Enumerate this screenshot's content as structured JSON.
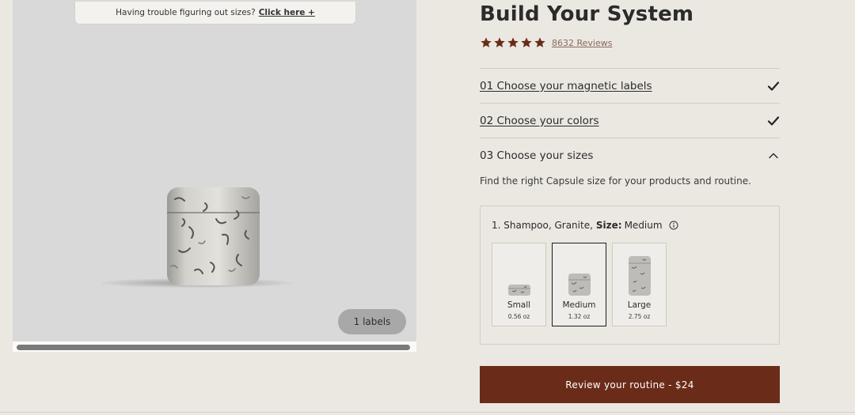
{
  "banner": {
    "text": "Having trouble figuring out sizes?",
    "link": "Click here +"
  },
  "gallery": {
    "labels_badge": "1 labels"
  },
  "product": {
    "title": "Build Your System",
    "rating_stars": 5,
    "reviews_label": "8632 Reviews"
  },
  "steps": [
    {
      "label": "01 Choose your magnetic labels",
      "state": "complete",
      "icon": "check-icon"
    },
    {
      "label": "02 Choose your colors",
      "state": "complete",
      "icon": "check-icon"
    },
    {
      "label": "03 Choose your sizes",
      "state": "expanded",
      "icon": "chevron-up-icon"
    }
  ],
  "sizes": {
    "description": "Find the right Capsule size for your products and routine.",
    "item_prefix": "1. Shampoo, Granite,",
    "size_key": "Size:",
    "selected_value": "Medium",
    "options": [
      {
        "name": "Small",
        "oz": "0.56 oz"
      },
      {
        "name": "Medium",
        "oz": "1.32 oz"
      },
      {
        "name": "Large",
        "oz": "2.75 oz"
      }
    ]
  },
  "cta": {
    "label": "Review your routine - $24"
  },
  "colors": {
    "accent": "#6a2c18",
    "star": "#6a2c18",
    "background": "#ebe8e2"
  }
}
